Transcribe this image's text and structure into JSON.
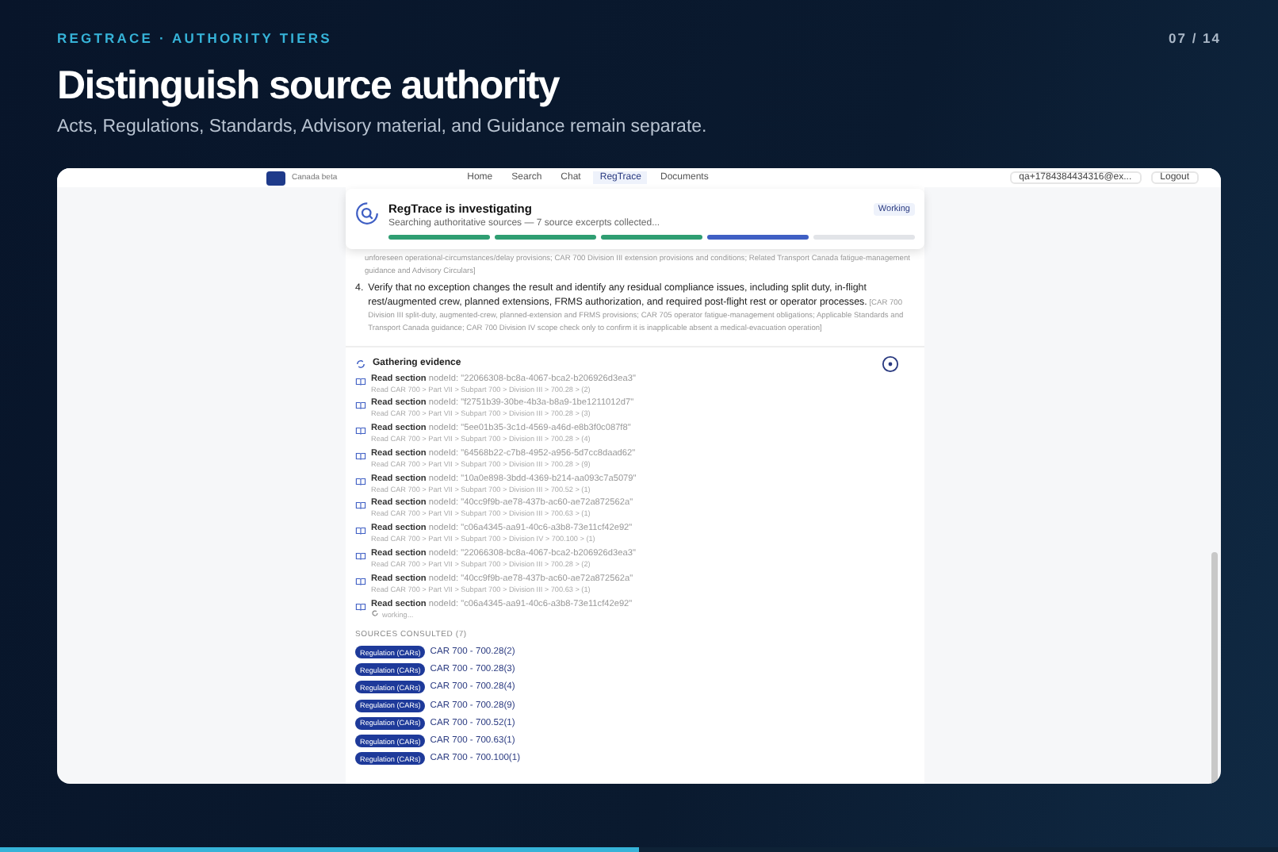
{
  "slide": {
    "kicker": "REGTRACE · AUTHORITY TIERS",
    "counter": "07 / 14",
    "title": "Distinguish source authority",
    "subtitle": "Acts, Regulations, Standards, Advisory material, and Guidance remain separate.",
    "progress": {
      "level": 0.5
    }
  },
  "app": {
    "brand": {
      "subtitle": "Canada beta"
    },
    "nav": [
      {
        "label": "Home",
        "selected": false
      },
      {
        "label": "Search",
        "selected": false
      },
      {
        "label": "Chat",
        "selected": false
      },
      {
        "label": "RegTrace",
        "selected": true
      },
      {
        "label": "Documents",
        "selected": false
      }
    ],
    "user": "qa+1784384434316@ex...",
    "logout": "Logout",
    "status": {
      "title": "RegTrace is investigating",
      "detail": "Searching authoritative sources — 7 source excerpts collected...",
      "badge": "Working",
      "steps": [
        {
          "done": true,
          "active": false
        },
        {
          "done": true,
          "active": false
        },
        {
          "done": true,
          "active": false
        },
        {
          "done": false,
          "active": true
        },
        {
          "done": false,
          "active": false
        }
      ]
    },
    "answer": {
      "fragment": "unforeseen operational-circumstances/delay provisions; CAR 700 Division III extension provisions and conditions; Related Transport Canada fatigue-management guidance and Advisory Circulars]",
      "items": [
        {
          "number": "4.",
          "text": "**Verify that no exception changes the result and identify any residual compliance issues, including split duty, in-flight rest/augmented crew, planned extensions, FRMS authorization, and required post-flight rest or operator processes.** [CAR 700 Division III split-duty, augmented-crew, planned-extension and FRMS provisions; CAR 705 operator fatigue-management obligations; Applicable Standards and Transport Canada guidance; CAR 700 Division IV scope check only to confirm it is inapplicable absent a medical-evacuation operation]"
        }
      ]
    },
    "evidence": {
      "title": "Gathering evidence",
      "items": [
        {
          "kind": "done",
          "action": "Read section",
          "detail": "nodeId: \"22066308-bc8a-4067-bca2-b206926d3ea3\"",
          "path": "Read CAR 700 > Part VII > Subpart 700 > Division III > 700.28 > (2)"
        },
        {
          "kind": "done",
          "action": "Read section",
          "detail": "nodeId: \"f2751b39-30be-4b3a-b8a9-1be1211012d7\"",
          "path": "Read CAR 700 > Part VII > Subpart 700 > Division III > 700.28 > (3)"
        },
        {
          "kind": "done",
          "action": "Read section",
          "detail": "nodeId: \"5ee01b35-3c1d-4569-a46d-e8b3f0c087f8\"",
          "path": "Read CAR 700 > Part VII > Subpart 700 > Division III > 700.28 > (4)"
        },
        {
          "kind": "done",
          "action": "Read section",
          "detail": "nodeId: \"64568b22-c7b8-4952-a956-5d7cc8daad62\"",
          "path": "Read CAR 700 > Part VII > Subpart 700 > Division III > 700.28 > (9)"
        },
        {
          "kind": "done",
          "action": "Read section",
          "detail": "nodeId: \"10a0e898-3bdd-4369-b214-aa093c7a5079\"",
          "path": "Read CAR 700 > Part VII > Subpart 700 > Division III > 700.52 > (1)"
        },
        {
          "kind": "done",
          "action": "Read section",
          "detail": "nodeId: \"40cc9f9b-ae78-437b-ac60-ae72a872562a\"",
          "path": "Read CAR 700 > Part VII > Subpart 700 > Division III > 700.63 > (1)"
        },
        {
          "kind": "done",
          "action": "Read section",
          "detail": "nodeId: \"c06a4345-aa91-40c6-a3b8-73e11cf42e92\"",
          "path": "Read CAR 700 > Part VII > Subpart 700 > Division IV > 700.100 > (1)"
        },
        {
          "kind": "done",
          "action": "Read section",
          "detail": "nodeId: \"22066308-bc8a-4067-bca2-b206926d3ea3\"",
          "path": "Read CAR 700 > Part VII > Subpart 700 > Division III > 700.28 > (2)"
        },
        {
          "kind": "done",
          "action": "Read section",
          "detail": "nodeId: \"40cc9f9b-ae78-437b-ac60-ae72a872562a\"",
          "path": "Read CAR 700 > Part VII > Subpart 700 > Division III > 700.63 > (1)"
        },
        {
          "kind": "working",
          "action": "Read section",
          "detail": "nodeId: \"c06a4345-aa91-40c6-a3b8-73e11cf42e92\"",
          "path": "working..."
        }
      ]
    },
    "sources": {
      "heading": "SOURCES CONSULTED (7)",
      "items": [
        {
          "tag": "Regulation (CARs)",
          "ref": "CAR 700 - 700.28(2)"
        },
        {
          "tag": "Regulation (CARs)",
          "ref": "CAR 700 - 700.28(3)"
        },
        {
          "tag": "Regulation (CARs)",
          "ref": "CAR 700 - 700.28(4)"
        },
        {
          "tag": "Regulation (CARs)",
          "ref": "CAR 700 - 700.28(9)"
        },
        {
          "tag": "Regulation (CARs)",
          "ref": "CAR 700 - 700.52(1)"
        },
        {
          "tag": "Regulation (CARs)",
          "ref": "CAR 700 - 700.63(1)"
        },
        {
          "tag": "Regulation (CARs)",
          "ref": "CAR 700 - 700.100(1)"
        }
      ]
    }
  }
}
